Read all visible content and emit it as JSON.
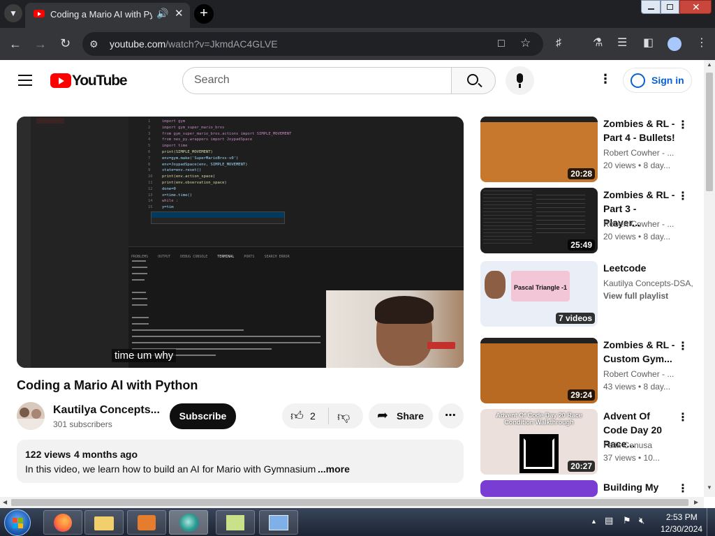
{
  "browser": {
    "tab_title": "Coding a Mario AI with Python",
    "url_host": "youtube.com",
    "url_path": "/watch?v=JkmdAC4GLVE"
  },
  "header": {
    "logo_text": "YouTube",
    "search_placeholder": "Search",
    "signin_label": "Sign in"
  },
  "video": {
    "caption": "time um why",
    "title": "Coding a Mario AI with Python",
    "channel": "Kautilya Concepts...",
    "subscribers": "301 subscribers",
    "subscribe_label": "Subscribe",
    "likes": "2",
    "share_label": "Share",
    "views": "122 views",
    "age": "4 months ago",
    "description": "In this video, we learn how to build an AI for Mario with Gymnasium",
    "more_label": "...more"
  },
  "code": {
    "lines": [
      "import gym",
      "import gym_super_mario_bros",
      "from gym_super_mario_bros.actions import SIMPLE_MOVEMENT",
      "from nes_py.wrappers import JoypadSpace",
      "import time",
      "print(SIMPLE_MOVEMENT)",
      "env=gym.make('SuperMarioBros-v0')",
      "env=JoypadSpace(env, SIMPLE_MOVEMENT)",
      "state=env.reset()",
      "print(env.action_space)",
      "print(env.observation_space)",
      "done=0",
      "x=time.time()",
      "while :",
      "y=tim"
    ],
    "terminal_tabs": [
      "PROBLEMS",
      "OUTPUT",
      "DEBUG CONSOLE",
      "TERMINAL",
      "PORTS",
      "SEARCH ERROR"
    ]
  },
  "sidebar": [
    {
      "title": "Zombies & RL - Part 4 - Bullets!",
      "channel": "Robert Cowher - ...",
      "meta": "20 views • 8 day...",
      "duration": "20:28",
      "color": "#c8782c"
    },
    {
      "title": "Zombies & RL - Part 3 - Player...",
      "channel": "Robert Cowher - ...",
      "meta": "20 views • 8 day...",
      "duration": "25:49",
      "color": "#1e1e1e"
    },
    {
      "title": "Leetcode",
      "channel": "Kautilya Concepts-DSA,",
      "meta": "View full playlist",
      "duration": "7 videos",
      "color": "#e9eef7"
    },
    {
      "title": "Zombies & RL - Custom Gym...",
      "channel": "Robert Cowher - ...",
      "meta": "43 views • 8 day...",
      "duration": "29:24",
      "color": "#b96a22"
    },
    {
      "title": "Advent Of Code Day 20 Race...",
      "channel": "Felix Cenusa",
      "meta": "37 views • 10...",
      "duration": "20:27",
      "color": "#ece0dc"
    },
    {
      "title": "Building My",
      "channel": "",
      "meta": "",
      "duration": "",
      "color": "#7a3dd4"
    }
  ],
  "playlist_thumb_title": "Pascal Triangle -1",
  "advent_thumb_title": "Advent Of Code Day 20 Race Condition Walkthrough",
  "taskbar": {
    "time": "2:53 PM",
    "date": "12/30/2024"
  }
}
